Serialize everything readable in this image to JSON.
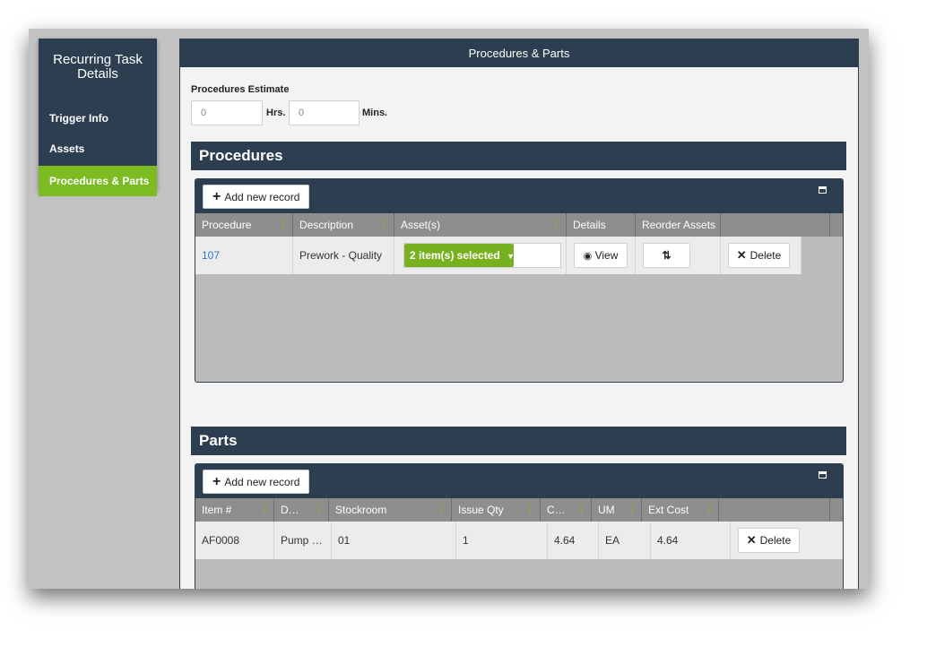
{
  "sidebar": {
    "title": "Recurring Task Details",
    "items": [
      {
        "label": "Trigger Info"
      },
      {
        "label": "Assets"
      },
      {
        "label": "Procedures & Parts"
      }
    ]
  },
  "main": {
    "title": "Procedures & Parts",
    "estimate": {
      "label": "Procedures Estimate",
      "hrs_value": "0",
      "hrs_unit": "Hrs.",
      "mins_value": "0",
      "mins_unit": "Mins."
    }
  },
  "procedures": {
    "section_title": "Procedures",
    "add_label": "Add new record",
    "columns": [
      "Procedure",
      "Description",
      "Asset(s)",
      "Details",
      "Reorder Assets"
    ],
    "rows": [
      {
        "procedure": "107",
        "description": "Prework - Quality",
        "assets": "2 item(s) selected",
        "view_label": "View",
        "delete_label": "Delete"
      }
    ]
  },
  "parts": {
    "section_title": "Parts",
    "add_label": "Add new record",
    "columns": [
      "Item #",
      "D…",
      "Stockroom",
      "Issue Qty",
      "C…",
      "UM",
      "Ext Cost"
    ],
    "rows": [
      {
        "item": "AF0008",
        "description": "Pump …",
        "stockroom": "01",
        "issue_qty": "1",
        "cost": "4.64",
        "um": "EA",
        "ext_cost": "4.64",
        "delete_label": "Delete"
      }
    ]
  },
  "colors": {
    "navy": "#2c3e50",
    "accent_green": "#7dbb22",
    "link_blue": "#2f74c0"
  },
  "icons": [
    "plus-icon",
    "maximize-icon",
    "eye-icon",
    "sort-icon",
    "close-icon",
    "caret-down-icon",
    "column-grip-icon"
  ]
}
